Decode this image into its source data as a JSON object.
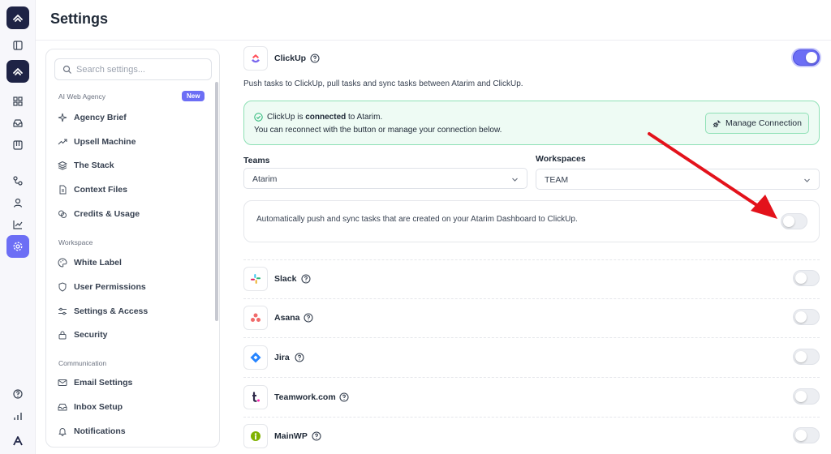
{
  "page": {
    "title": "Settings"
  },
  "rail": {
    "icons": [
      "atarim-logo-icon",
      "sidebar-toggle-icon",
      "atarim-app-icon",
      "dashboard-grid-icon",
      "inbox-icon",
      "board-icon",
      "integrations-icon",
      "user-icon",
      "analytics-icon",
      "settings-icon",
      "help-icon",
      "stats-icon",
      "atarim-brand-icon"
    ]
  },
  "settings_nav": {
    "search_placeholder": "Search settings...",
    "new_badge": "New",
    "sections": [
      {
        "title": "AI Web Agency",
        "items": [
          "Agency Brief",
          "Upsell Machine",
          "The Stack",
          "Context Files",
          "Credits & Usage"
        ]
      },
      {
        "title": "Workspace",
        "items": [
          "White Label",
          "User Permissions",
          "Settings & Access",
          "Security"
        ]
      },
      {
        "title": "Communication",
        "items": [
          "Email Settings",
          "Inbox Setup",
          "Notifications"
        ]
      }
    ]
  },
  "clickup": {
    "name": "ClickUp",
    "enabled": true,
    "description": "Push tasks to ClickUp, pull tasks and sync tasks between Atarim and ClickUp.",
    "status_prefix": "ClickUp is ",
    "status_bold": "connected",
    "status_suffix": " to Atarim.",
    "status_line2": "You can reconnect with the button or manage your connection below.",
    "manage_button": "Manage Connection",
    "teams_label": "Teams",
    "teams_value": "Atarim",
    "workspaces_label": "Workspaces",
    "workspaces_value": "TEAM",
    "auto_sync_text": "Automatically push and sync tasks that are created on your Atarim Dashboard to ClickUp.",
    "auto_sync_enabled": false
  },
  "integrations": [
    {
      "name": "Slack",
      "enabled": false
    },
    {
      "name": "Asana",
      "enabled": false
    },
    {
      "name": "Jira",
      "enabled": false
    },
    {
      "name": "Teamwork.com",
      "enabled": false
    },
    {
      "name": "MainWP",
      "enabled": false
    }
  ],
  "colors": {
    "accent": "#6c6ef5",
    "rail_dark": "#1e2345",
    "success_border": "#8ee0b5",
    "success_bg": "#eefbf4",
    "annotation_arrow": "#e3121b"
  }
}
